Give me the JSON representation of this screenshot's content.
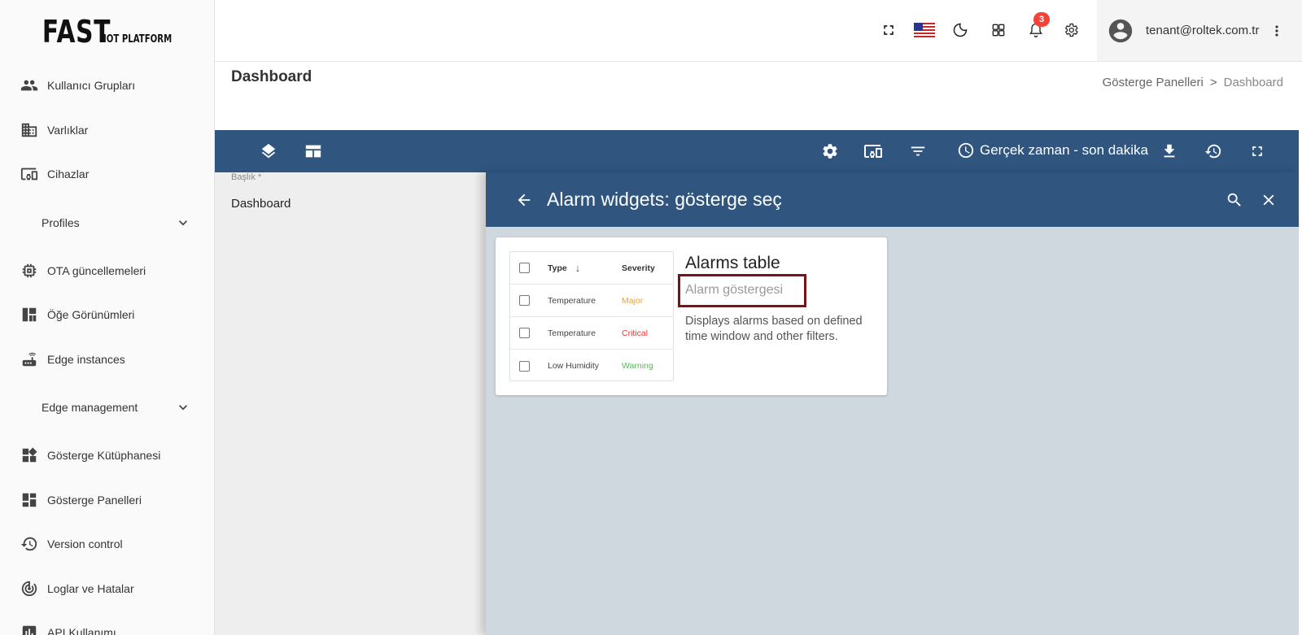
{
  "logo": {
    "main": "FAST",
    "sub": "IOT PLATFORM"
  },
  "sidebar": {
    "items": [
      {
        "label": "Kullanıcı Grupları",
        "icon": "user-group-icon"
      },
      {
        "label": "Varlıklar",
        "icon": "building-icon"
      },
      {
        "label": "Cihazlar",
        "icon": "devices-icon"
      },
      {
        "label": "Profiles",
        "icon": "chevron-down-icon",
        "group": true
      },
      {
        "label": "OTA güncellemeleri",
        "icon": "chip-icon"
      },
      {
        "label": "Öğe Görünümleri",
        "icon": "view-quilt-icon"
      },
      {
        "label": "Edge instances",
        "icon": "router-icon"
      },
      {
        "label": "Edge management",
        "icon": "chevron-down-icon",
        "group": true
      },
      {
        "label": "Gösterge Kütüphanesi",
        "icon": "widgets-icon"
      },
      {
        "label": "Gösterge Panelleri",
        "icon": "dashboard-icon"
      },
      {
        "label": "Version control",
        "icon": "history-icon"
      },
      {
        "label": "Loglar ve Hatalar",
        "icon": "track-changes-icon"
      },
      {
        "label": "API Kullanımı",
        "icon": "bar-chart-icon"
      }
    ]
  },
  "topbar": {
    "notification_count": "3",
    "user_email": "tenant@roltek.com.tr"
  },
  "page": {
    "title": "Dashboard",
    "breadcrumb": [
      "Gösterge Panelleri",
      ">",
      "Dashboard"
    ]
  },
  "dashboard_toolbar": {
    "realtime_label": "Gerçek zaman - son dakika"
  },
  "edit_pane": {
    "field_label": "Başlık *",
    "field_value": "Dashboard"
  },
  "selector": {
    "title": "Alarm widgets: gösterge seç",
    "widget": {
      "title": "Alarms table",
      "subtitle": "Alarm göstergesi",
      "description": "Displays alarms based on defined time window and other filters.",
      "preview": {
        "headers": [
          "Type",
          "Severity"
        ],
        "rows": [
          {
            "type": "Temperature",
            "severity": "Major"
          },
          {
            "type": "Temperature",
            "severity": "Critical"
          },
          {
            "type": "Low Humidity",
            "severity": "Warning"
          }
        ]
      }
    }
  },
  "colors": {
    "primary": "#305680",
    "major": "#f2a524",
    "critical": "#e53935",
    "warning": "#5cb85c",
    "highlight": "#7a1414",
    "badge": "#f44336"
  }
}
